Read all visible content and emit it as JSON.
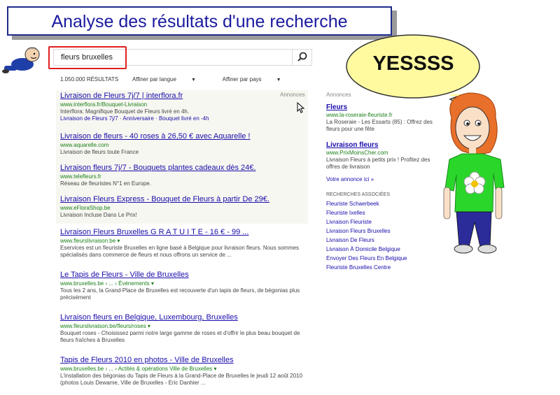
{
  "slide_title": "Analyse des résultats d'une recherche",
  "search": {
    "query": "fleurs bruxelles"
  },
  "results_count": "1.050.000 RÉSULTATS",
  "filters": [
    "Affiner par langue",
    "Affiner par pays"
  ],
  "ads_label": "Annonces",
  "results": [
    {
      "title": "Livraison de Fleurs 7j/7 | interflora.fr",
      "url": "www.interflora.fr/Bouquet-Livraison",
      "snippet": "Interflora: Magnifique Bouquet de Fleurs livré en 4h.",
      "sitelinks": "Livraison de Fleurs 7j/7 · Anniversaire · Bouquet livré en -4h"
    },
    {
      "title": "Livraison de fleurs - 40 roses à 26,50 € avec Aquarelle !",
      "url": "www.aquarelle.com",
      "snippet": "Livraison de fleurs toute France"
    },
    {
      "title": "Livraison fleurs 7j/7 - Bouquets plantes cadeaux dès 24€.",
      "url": "www.telefleurs.fr",
      "snippet": "Réseau de fleuristes N°1 en Europe."
    },
    {
      "title": "Livraison Fleurs Express - Bouquet de Fleurs à partir De 29€.",
      "url": "www.eFloraShop.be",
      "snippet": "Livraison Incluse Dans Le Prix!"
    },
    {
      "title": "Livraison Fleurs Bruxelles G R A T U I T E - 16 € - 99 ...",
      "url": "www.fleurslivraison.be ▾",
      "snippet": "Eservices est un fleuriste Bruxelles en ligne basé à Belgique pour livraison fleurs. Nous sommes spécialisés dans commerce de fleurs et nous offrons un service de ..."
    },
    {
      "title": "Le Tapis de Fleurs - Ville de Bruxelles",
      "url": "www.bruxelles.be › ... › Événements ▾",
      "snippet": "Tous les 2 ans, la Grand-Place de Bruxelles est recouverte d'un tapis de fleurs, de bégonias plus précisément"
    },
    {
      "title": "Livraison fleurs en Belgique, Luxembourg, Bruxelles",
      "url": "www.fleurslivraison.be/fleurs/roses ▾",
      "snippet": "Bouquet roses - Choisissez parmi notre large gamme de roses et d'offrir le plus beau bouquet de fleurs fraîches à Bruxelles"
    },
    {
      "title": "Tapis de Fleurs 2010 en photos - Ville de Bruxelles",
      "url": "www.bruxelles.be › ... › Actités & opérations Ville de Bruxelles ▾",
      "snippet": "L'installation des bégonias du Tapis de Fleurs à la Grand-Place de Bruxelles le jeudi 12 août 2010 (photos Louis Dewame, Ville de Bruxelles - Eric Danhier ..."
    }
  ],
  "side_ads": [
    {
      "title": "Fleurs",
      "url": "www.la-roseraie-fleuriste.fr",
      "snippet": "La Roseraie - Les Essarts (85) : Offrez des fleurs pour une fête"
    },
    {
      "title": "Livraison fleurs",
      "url": "www.PrixMoinsCher.com",
      "snippet": "Livraison Fleurs à petits prix ! Profitez des offres de livraison"
    }
  ],
  "your_ad_link": "Votre annonce ici »",
  "related_heading": "RECHERCHES ASSOCIÉES",
  "related": [
    "Fleuriste Schaerbeek",
    "Fleuriste Ixelles",
    "Livraison Fleuriste",
    "Livraison Fleurs Bruxelles",
    "Livraison De Fleurs",
    "Livraison À Domicile Belgique",
    "Envoyer Des Fleurs En Belgique",
    "Fleuriste Bruxelles Centre"
  ],
  "speech": "YESSSS",
  "colors": {
    "link": "#1a0dab",
    "url": "#1a7f1a",
    "highlight": "#e02020",
    "title": "#1a1aa0",
    "bubble": "#fffaa0"
  }
}
